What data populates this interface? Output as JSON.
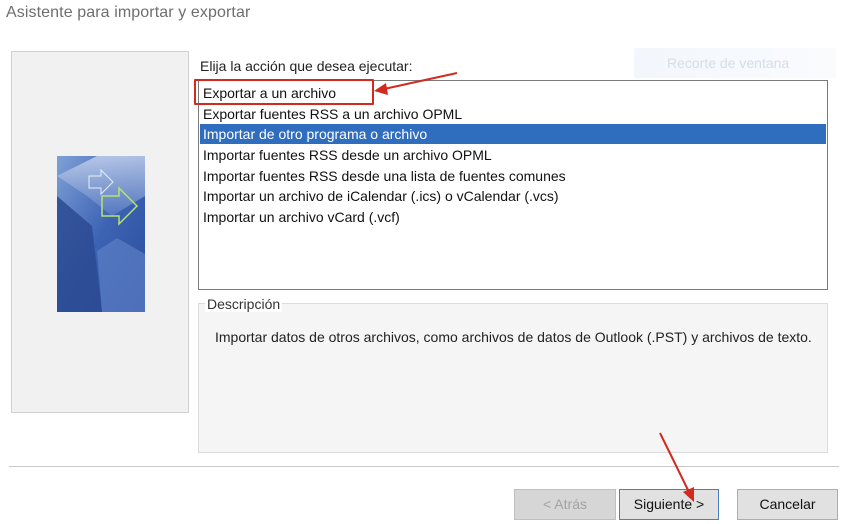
{
  "window": {
    "title": "Asistente para importar y exportar"
  },
  "main": {
    "action_prompt": "Elija la acción que desea ejecutar:",
    "options": [
      {
        "label": "Exportar a un archivo",
        "selected": false
      },
      {
        "label": "Exportar fuentes RSS a un archivo OPML",
        "selected": false
      },
      {
        "label": "Importar de otro programa o archivo",
        "selected": true
      },
      {
        "label": "Importar fuentes RSS desde un archivo OPML",
        "selected": false
      },
      {
        "label": "Importar fuentes RSS desde una lista de fuentes comunes",
        "selected": false
      },
      {
        "label": "Importar un archivo de iCalendar (.ics) o vCalendar (.vcs)",
        "selected": false
      },
      {
        "label": "Importar un archivo vCard (.vcf)",
        "selected": false
      }
    ],
    "description": {
      "title": "Descripción",
      "text": "Importar datos de otros archivos, como archivos de datos de Outlook (.PST) y archivos de texto."
    }
  },
  "overlay": {
    "snip_watermark": "Recorte de ventana"
  },
  "footer": {
    "back_label": "< Atrás",
    "next_label": "Siguiente >",
    "cancel_label": "Cancelar"
  },
  "colors": {
    "selection": "#2f6dbf",
    "annotation_red": "#d32a1f"
  }
}
